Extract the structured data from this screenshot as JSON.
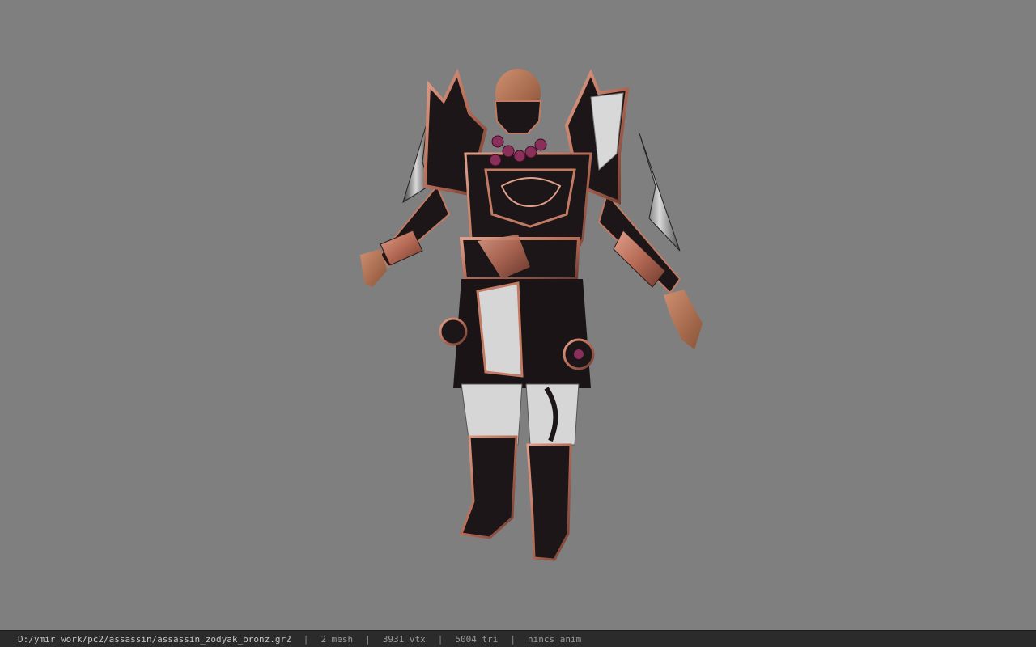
{
  "viewer": {
    "background_color": "#7f7f7f",
    "model_name": "assassin_zodyak_bronz"
  },
  "status_bar": {
    "file_path": "D:/ymir work/pc2/assassin/assassin_zodyak_bronz.gr2",
    "separator": "|",
    "mesh_count": "2 mesh",
    "vertex_count": "3931 vtx",
    "triangle_count": "5004 tri",
    "animation": "nincs anim"
  },
  "colors": {
    "armor_dark": "#1c1618",
    "armor_copper": "#c27a63",
    "skin": "#b27450",
    "cloth_white": "#d6d6d6",
    "beads": "#8a2e5a"
  }
}
